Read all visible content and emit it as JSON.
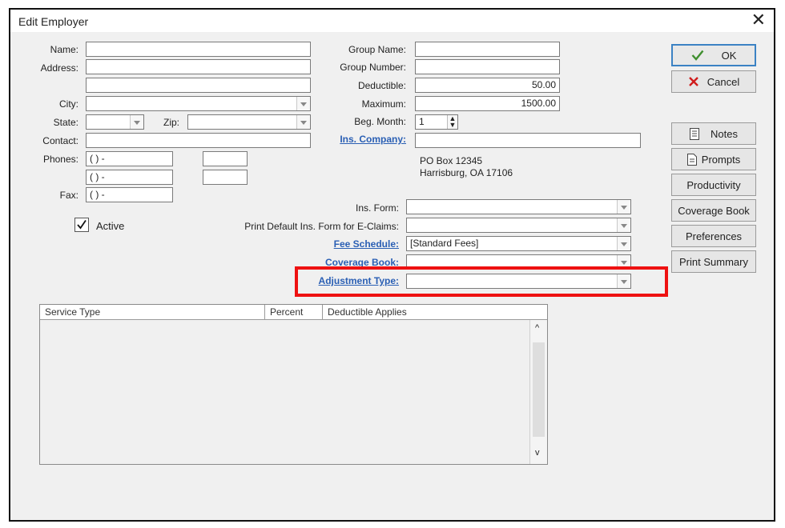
{
  "window": {
    "title": "Edit Employer",
    "close_glyph": "✕"
  },
  "left": {
    "name_label": "Name:",
    "address_label": "Address:",
    "city_label": "City:",
    "state_label": "State:",
    "zip_label": "Zip:",
    "contact_label": "Contact:",
    "phones_label": "Phones:",
    "fax_label": "Fax:",
    "phone1": "( )  -",
    "phone2": "( )  -",
    "fax": "( )  -",
    "active_label": "Active",
    "active_checked": true
  },
  "right": {
    "group_name_label": "Group Name:",
    "group_number_label": "Group Number:",
    "deductible_label": "Deductible:",
    "deductible_value": "50.00",
    "maximum_label": "Maximum:",
    "maximum_value": "1500.00",
    "beg_month_label": "Beg. Month:",
    "beg_month_value": "1",
    "ins_company_label": "Ins. Company:",
    "address_line1": "PO Box 12345",
    "address_line2": "Harrisburg, OA 17106",
    "ins_form_label": "Ins. Form:",
    "print_default_label": "Print Default Ins. Form for E-Claims:",
    "fee_schedule_label": "Fee Schedule:",
    "fee_schedule_value": "[Standard Fees]",
    "coverage_book_label": "Coverage Book:",
    "adjustment_type_label": "Adjustment Type:"
  },
  "buttons": {
    "ok": "OK",
    "cancel": "Cancel",
    "notes": "Notes",
    "prompts": "Prompts",
    "productivity": "Productivity",
    "coverage_book": "Coverage Book",
    "preferences": "Preferences",
    "print_summary": "Print Summary"
  },
  "grid": {
    "columns": [
      "Service Type",
      "Percent",
      "Deductible Applies"
    ],
    "scroll_up": "^",
    "scroll_down": "v"
  },
  "colors": {
    "highlight": "#e11111",
    "link": "#2a5fb4",
    "ok_border": "#3b82c4"
  }
}
